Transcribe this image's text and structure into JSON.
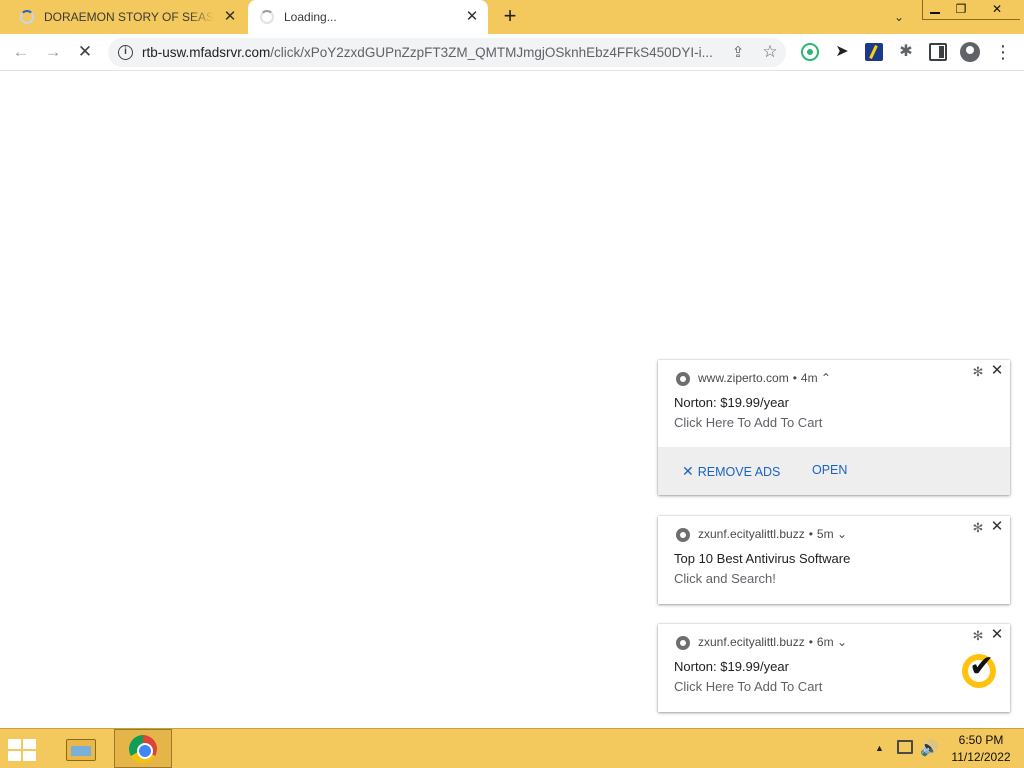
{
  "browser": {
    "tabs": [
      {
        "title": "DORAEMON STORY OF SEASON",
        "close": "✕"
      },
      {
        "title": "Loading...",
        "close": "✕"
      }
    ],
    "new_tab": "+",
    "tab_search": "⌄",
    "window_controls": {
      "minimize": "",
      "maximize": "❐",
      "close": "✕"
    }
  },
  "toolbar": {
    "back": "←",
    "forward": "→",
    "stop": "✕",
    "url_host": "rtb-usw.mfadsrvr.com",
    "url_path": "/click/xPoY2zxdGUPnZzpFT3ZM_QMTMJmgjOSknhEbz4FFkS450DYI-i...",
    "share": "⇪",
    "star": "☆",
    "cursor_ext": "➤",
    "puzzle": "✱",
    "menu": "⋮",
    "info": "i"
  },
  "notifications": [
    {
      "source": "www.ziperto.com",
      "age": "4m",
      "caret": "⌃",
      "title": "Norton: $19.99/year",
      "body": "Click Here To Add To Cart",
      "actions": {
        "remove_ads": "REMOVE ADS",
        "remove_x": "✕",
        "open": "OPEN"
      }
    },
    {
      "source": "zxunf.ecityalittl.buzz",
      "age": "5m",
      "caret": "⌄",
      "title": "Top 10 Best Antivirus Software",
      "body": "Click and Search!"
    },
    {
      "source": "zxunf.ecityalittl.buzz",
      "age": "6m",
      "caret": "⌄",
      "title": "Norton: $19.99/year",
      "body": "Click Here To Add To Cart"
    }
  ],
  "notif_common": {
    "dot": "•",
    "gear": "✻",
    "close": "✕"
  },
  "taskbar": {
    "tray_up": "▲",
    "volume": "🔊",
    "time": "6:50 PM",
    "date": "11/12/2022"
  },
  "colors": {
    "frame": "#f3c85c",
    "link_blue": "#1a64c4",
    "norton_yellow": "#ffc20e"
  }
}
